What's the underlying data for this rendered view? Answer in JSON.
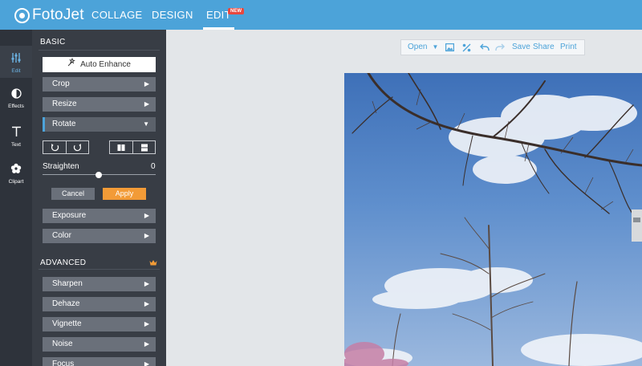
{
  "app": {
    "logo_text": "FotoJet",
    "nav": [
      {
        "label": "COLLAGE"
      },
      {
        "label": "DESIGN"
      },
      {
        "label": "EDIT",
        "badge": "NEW"
      }
    ]
  },
  "rail": [
    {
      "label": "Edit",
      "icon": "sliders-icon"
    },
    {
      "label": "Effects",
      "icon": "half-circle-icon"
    },
    {
      "label": "Text",
      "icon": "text-t-icon"
    },
    {
      "label": "Clipart",
      "icon": "flower-icon"
    }
  ],
  "panel": {
    "basic_title": "BASIC",
    "auto_enhance": "Auto Enhance",
    "crop": "Crop",
    "resize": "Resize",
    "rotate": "Rotate",
    "straighten_label": "Straighten",
    "straighten_value": "0",
    "straighten_fraction": 0.5,
    "cancel": "Cancel",
    "apply": "Apply",
    "exposure": "Exposure",
    "color": "Color",
    "advanced_title": "ADVANCED",
    "advanced": [
      "Sharpen",
      "Dehaze",
      "Vignette",
      "Noise",
      "Focus"
    ]
  },
  "toolbar": {
    "open": "Open",
    "save": "Save",
    "share": "Share",
    "print": "Print"
  },
  "colors": {
    "brand": "#4ca3d9",
    "apply": "#f29b37",
    "crown": "#f29b37",
    "badge": "#e8483f"
  }
}
